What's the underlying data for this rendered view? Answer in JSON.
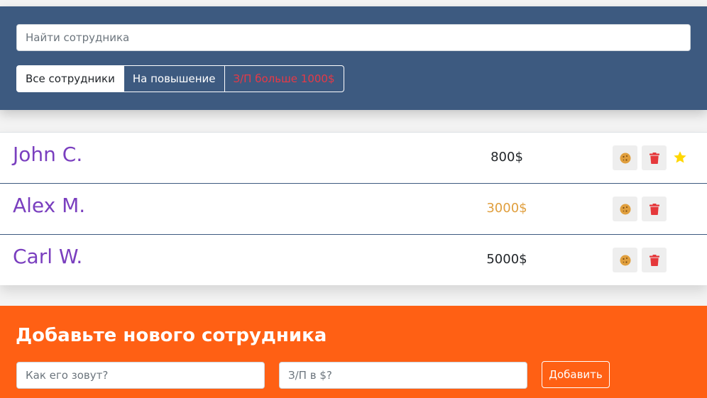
{
  "search": {
    "placeholder": "Найти сотрудника"
  },
  "filters": {
    "all": "Все сотрудники",
    "rise": "На повышение",
    "salary": "З/П больше 1000$"
  },
  "employees": [
    {
      "name": "John C.",
      "salary": "800$",
      "increase": false,
      "star": true
    },
    {
      "name": "Alex M.",
      "salary": "3000$",
      "increase": true,
      "star": false
    },
    {
      "name": "Carl W.",
      "salary": "5000$",
      "increase": false,
      "star": false
    }
  ],
  "add_form": {
    "title": "Добавьте нового сотрудника",
    "name_placeholder": "Как его зовут?",
    "salary_placeholder": "З/П в $?",
    "submit_label": "Добавить"
  },
  "colors": {
    "search_panel": "#3d5a80",
    "add_panel": "#ff6014",
    "name_text": "#7a3fbf",
    "increase_salary": "#e09f3e",
    "cookie_icon": "#e09f3e",
    "trash_icon": "#e5383b",
    "star_icon": "#ffd700"
  },
  "icons": {
    "increase": "cookie-icon",
    "delete": "trash-icon",
    "rise": "star-icon"
  }
}
